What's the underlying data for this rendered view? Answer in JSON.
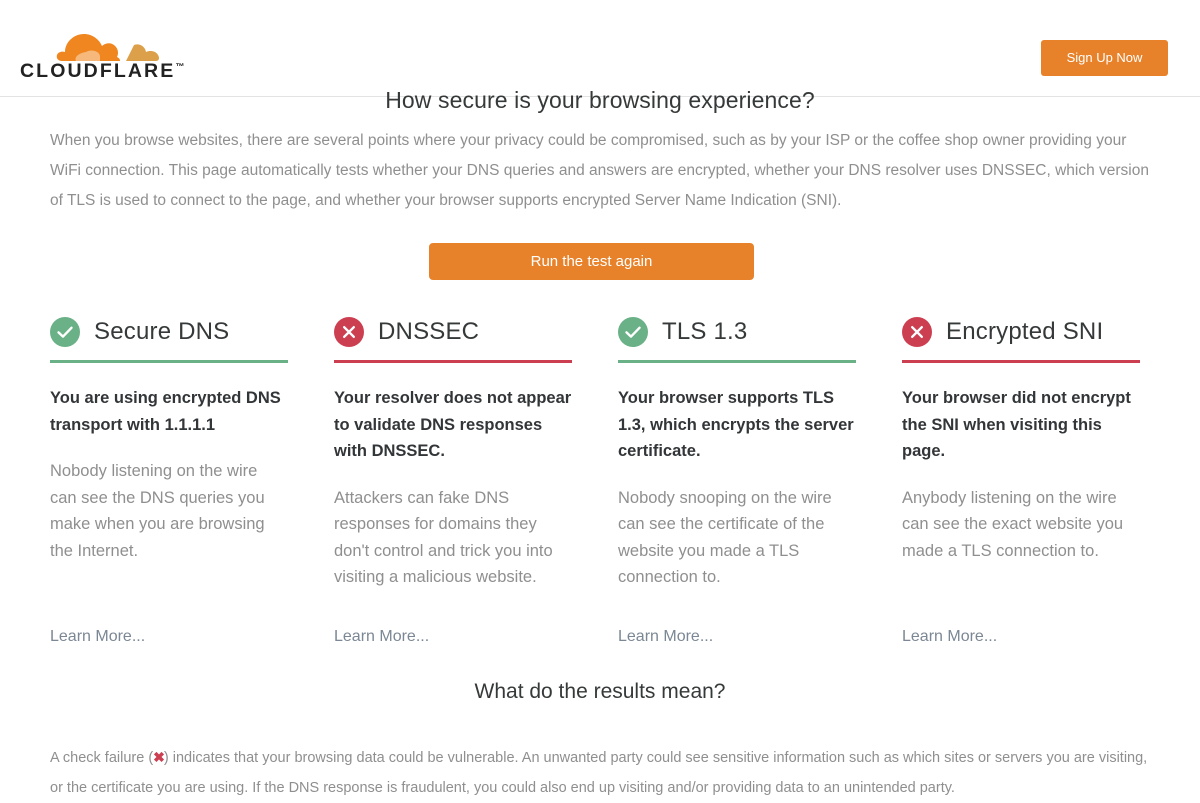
{
  "brand": {
    "logo_text": "CLOUDFLARE",
    "logo_tm": "™",
    "accent_orange": "#e8822a",
    "pass_green": "#6ab187",
    "fail_red": "#cc3f51"
  },
  "header": {
    "signup_label": "Sign Up Now"
  },
  "intro": {
    "title": "How secure is your browsing experience?",
    "paragraph": "When you browse websites, there are several points where your privacy could be compromised, such as by your ISP or the coffee shop owner providing your WiFi connection. This page automatically tests whether your DNS queries and answers are encrypted, whether your DNS resolver uses DNSSEC, which version of TLS is used to connect to the page, and whether your browser supports encrypted Server Name Indication (SNI).",
    "run_test_label": "Run the test again"
  },
  "cards": [
    {
      "title": "Secure DNS",
      "status": "pass",
      "icon": "check-circle-icon",
      "summary": "You are using encrypted DNS transport with 1.1.1.1",
      "detail": "Nobody listening on the wire can see the DNS queries you make when you are browsing the Internet.",
      "learn_more": "Learn More..."
    },
    {
      "title": "DNSSEC",
      "status": "fail",
      "icon": "x-circle-icon",
      "summary": "Your resolver does not appear to validate DNS responses with DNSSEC.",
      "detail": "Attackers can fake DNS responses for domains they don't control and trick you into visiting a malicious website.",
      "learn_more": "Learn More..."
    },
    {
      "title": "TLS 1.3",
      "status": "pass",
      "icon": "check-circle-icon",
      "summary": "Your browser supports TLS 1.3, which encrypts the server certificate.",
      "detail": "Nobody snooping on the wire can see the certificate of the website you made a TLS connection to.",
      "learn_more": "Learn More..."
    },
    {
      "title": "Encrypted SNI",
      "status": "fail",
      "icon": "x-circle-icon",
      "summary": "Your browser did not encrypt the SNI when visiting this page.",
      "detail": "Anybody listening on the wire can see the exact website you made a TLS connection to.",
      "learn_more": "Learn More..."
    }
  ],
  "footer": {
    "title": "What do the results mean?",
    "note_before": "A check failure (",
    "note_x_glyph": "✖",
    "note_after": ") indicates that your browsing data could be vulnerable. An unwanted party could see sensitive information such as which sites or servers you are visiting, or the certificate you are using. If the DNS response is fraudulent, you could also end up visiting and/or providing data to an unintended party."
  }
}
